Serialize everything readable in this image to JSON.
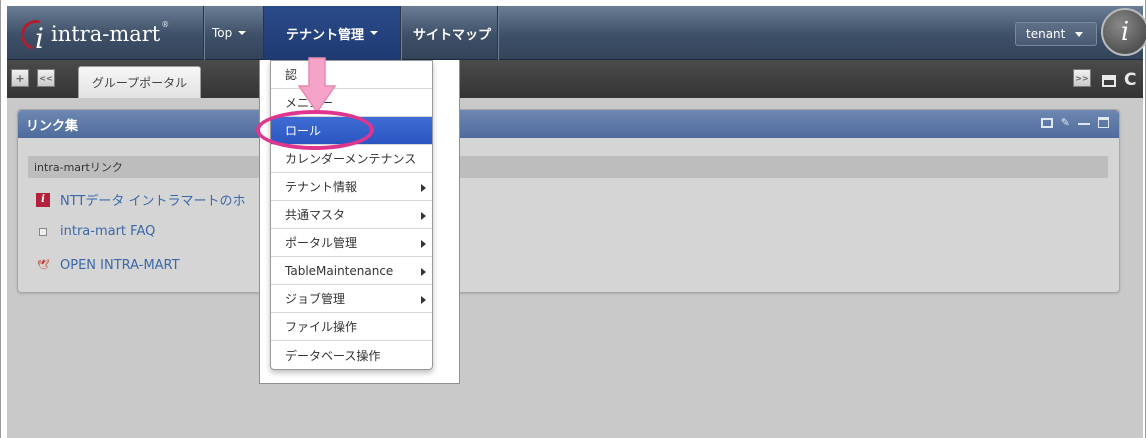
{
  "navbar": {
    "logo_text": "intra-mart",
    "logo_reg": "®",
    "top_label": "Top",
    "tenant_menu_label": "テナント管理",
    "sitemap_label": "サイトマップ",
    "user_button_label": "tenant"
  },
  "tabbar": {
    "add_label": "+",
    "prev_label": "<<",
    "next_label": ">>",
    "active_tab_label": "グループポータル"
  },
  "portlet": {
    "title": "リンク集",
    "section_label": "intra-martリンク",
    "links": [
      {
        "label": "NTTデータ イントラマートのホ",
        "icon": "intra-mart-icon"
      },
      {
        "label": "intra-mart FAQ",
        "icon": "document-icon"
      },
      {
        "label": "OPEN INTRA-MART",
        "icon": "bird-icon"
      }
    ]
  },
  "dropdown": {
    "items": [
      {
        "label": "認",
        "has_submenu": false,
        "active": false
      },
      {
        "label": "メニュー",
        "has_submenu": false,
        "active": false
      },
      {
        "label": "ロール",
        "has_submenu": false,
        "active": true
      },
      {
        "label": "カレンダーメンテナンス",
        "has_submenu": false,
        "active": false
      },
      {
        "label": "テナント情報",
        "has_submenu": true,
        "active": false
      },
      {
        "label": "共通マスタ",
        "has_submenu": true,
        "active": false
      },
      {
        "label": "ポータル管理",
        "has_submenu": true,
        "active": false
      },
      {
        "label": "TableMaintenance",
        "has_submenu": true,
        "active": false
      },
      {
        "label": "ジョブ管理",
        "has_submenu": true,
        "active": false
      },
      {
        "label": "ファイル操作",
        "has_submenu": false,
        "active": false
      },
      {
        "label": "データベース操作",
        "has_submenu": false,
        "active": false
      }
    ]
  },
  "colors": {
    "navbar": "#3e5068",
    "active_menu": "#2b56c2",
    "portlet_header": "#4e6b9c",
    "highlight": "#e0358f",
    "pointer_arrow": "#f5a3c8"
  }
}
